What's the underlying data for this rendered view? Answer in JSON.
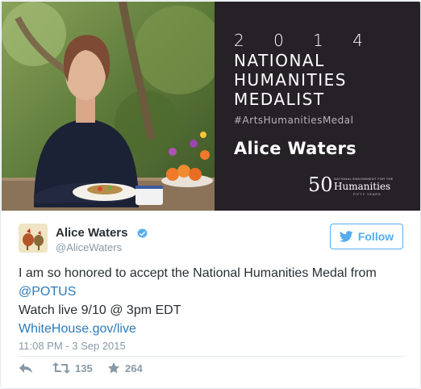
{
  "media": {
    "year": "2 0 1 4",
    "medal_lines": [
      "NATIONAL",
      "HUMANITIES",
      "MEDALIST"
    ],
    "hashtag": "#ArtsHumanitiesMedal",
    "honoree": "Alice Waters",
    "logo": {
      "fifty": "50",
      "small": "NATIONAL ENDOWMENT FOR THE",
      "name": "Humanities",
      "years": "FIFTY YEARS"
    }
  },
  "author": {
    "display_name": "Alice Waters",
    "handle": "@AliceWaters",
    "verified_icon": "verified-badge-icon"
  },
  "follow": {
    "label": "Follow",
    "icon": "bird-icon"
  },
  "tweet": {
    "text_1": "I am so honored to accept the National Humanities Medal from",
    "mention": "@POTUS",
    "text_2": "Watch live 9/10 @ 3pm EDT",
    "link": "WhiteHouse.gov/live",
    "timestamp": "11:08 PM - 3 Sep 2015"
  },
  "actions": {
    "retweets": "135",
    "likes": "264"
  },
  "colors": {
    "accent": "#55acee",
    "link": "#2b7bb9",
    "muted": "#8899a6",
    "panel": "#252126"
  }
}
